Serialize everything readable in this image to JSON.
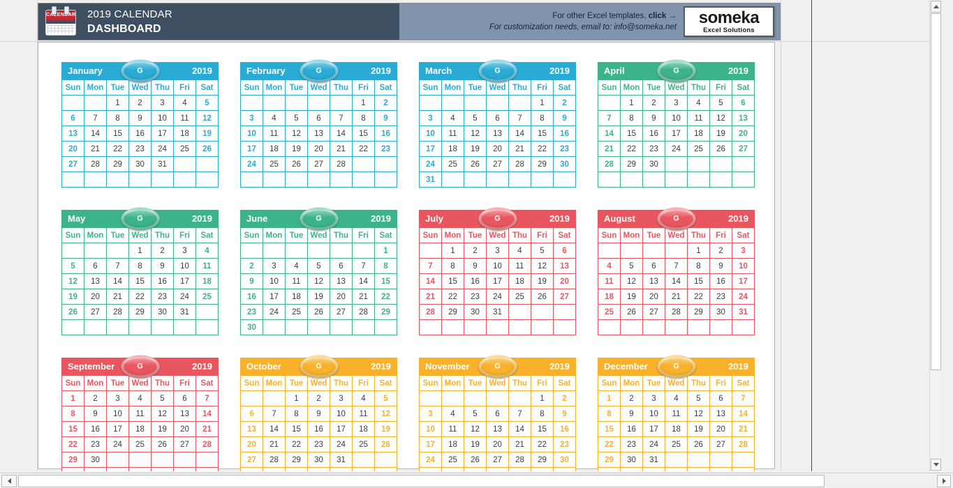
{
  "header": {
    "title_small": "2019 CALENDAR",
    "title_large": "DASHBOARD",
    "icon_label": "CALENDAR",
    "promo_line1_plain": "For other Excel templates, ",
    "promo_line1_bold": "click →",
    "promo_line2": "For customization needs, email to: info@someka.net",
    "logo_name": "someka",
    "logo_tagline": "Excel Solutions"
  },
  "badge_label": "G",
  "year": "2019",
  "weekdays": [
    "Sun",
    "Mon",
    "Tue",
    "Wed",
    "Thu",
    "Fri",
    "Sat"
  ],
  "colors": {
    "blue": "#29ABD4",
    "green": "#3DB38B",
    "red": "#E8575F",
    "orange": "#F7B12B",
    "banner_dark": "#3F4F62",
    "banner_light": "#8094AD",
    "weekday_text": "#3B3B3B"
  },
  "months": [
    {
      "name": "January",
      "color": "blue",
      "weeks": [
        [
          "",
          "",
          "1",
          "2",
          "3",
          "4",
          "5"
        ],
        [
          "6",
          "7",
          "8",
          "9",
          "10",
          "11",
          "12"
        ],
        [
          "13",
          "14",
          "15",
          "16",
          "17",
          "18",
          "19"
        ],
        [
          "20",
          "21",
          "22",
          "23",
          "24",
          "25",
          "26"
        ],
        [
          "27",
          "28",
          "29",
          "30",
          "31",
          "",
          ""
        ],
        [
          "",
          "",
          "",
          "",
          "",
          "",
          ""
        ]
      ]
    },
    {
      "name": "February",
      "color": "blue",
      "weeks": [
        [
          "",
          "",
          "",
          "",
          "",
          "1",
          "2"
        ],
        [
          "3",
          "4",
          "5",
          "6",
          "7",
          "8",
          "9"
        ],
        [
          "10",
          "11",
          "12",
          "13",
          "14",
          "15",
          "16"
        ],
        [
          "17",
          "18",
          "19",
          "20",
          "21",
          "22",
          "23"
        ],
        [
          "24",
          "25",
          "26",
          "27",
          "28",
          "",
          ""
        ],
        [
          "",
          "",
          "",
          "",
          "",
          "",
          ""
        ]
      ]
    },
    {
      "name": "March",
      "color": "blue",
      "weeks": [
        [
          "",
          "",
          "",
          "",
          "",
          "1",
          "2"
        ],
        [
          "3",
          "4",
          "5",
          "6",
          "7",
          "8",
          "9"
        ],
        [
          "10",
          "11",
          "12",
          "13",
          "14",
          "15",
          "16"
        ],
        [
          "17",
          "18",
          "19",
          "20",
          "21",
          "22",
          "23"
        ],
        [
          "24",
          "25",
          "26",
          "27",
          "28",
          "29",
          "30"
        ],
        [
          "31",
          "",
          "",
          "",
          "",
          "",
          ""
        ]
      ]
    },
    {
      "name": "April",
      "color": "green",
      "weeks": [
        [
          "",
          "1",
          "2",
          "3",
          "4",
          "5",
          "6"
        ],
        [
          "7",
          "8",
          "9",
          "10",
          "11",
          "12",
          "13"
        ],
        [
          "14",
          "15",
          "16",
          "17",
          "18",
          "19",
          "20"
        ],
        [
          "21",
          "22",
          "23",
          "24",
          "25",
          "26",
          "27"
        ],
        [
          "28",
          "29",
          "30",
          "",
          "",
          "",
          ""
        ],
        [
          "",
          "",
          "",
          "",
          "",
          "",
          ""
        ]
      ]
    },
    {
      "name": "May",
      "color": "green",
      "weeks": [
        [
          "",
          "",
          "",
          "1",
          "2",
          "3",
          "4"
        ],
        [
          "5",
          "6",
          "7",
          "8",
          "9",
          "10",
          "11"
        ],
        [
          "12",
          "13",
          "14",
          "15",
          "16",
          "17",
          "18"
        ],
        [
          "19",
          "20",
          "21",
          "22",
          "23",
          "24",
          "25"
        ],
        [
          "26",
          "27",
          "28",
          "29",
          "30",
          "31",
          ""
        ],
        [
          "",
          "",
          "",
          "",
          "",
          "",
          ""
        ]
      ]
    },
    {
      "name": "June",
      "color": "green",
      "weeks": [
        [
          "",
          "",
          "",
          "",
          "",
          "",
          "1"
        ],
        [
          "2",
          "3",
          "4",
          "5",
          "6",
          "7",
          "8"
        ],
        [
          "9",
          "10",
          "11",
          "12",
          "13",
          "14",
          "15"
        ],
        [
          "16",
          "17",
          "18",
          "19",
          "20",
          "21",
          "22"
        ],
        [
          "23",
          "24",
          "25",
          "26",
          "27",
          "28",
          "29"
        ],
        [
          "30",
          "",
          "",
          "",
          "",
          "",
          ""
        ]
      ]
    },
    {
      "name": "July",
      "color": "red",
      "weeks": [
        [
          "",
          "1",
          "2",
          "3",
          "4",
          "5",
          "6"
        ],
        [
          "7",
          "8",
          "9",
          "10",
          "11",
          "12",
          "13"
        ],
        [
          "14",
          "15",
          "16",
          "17",
          "18",
          "19",
          "20"
        ],
        [
          "21",
          "22",
          "23",
          "24",
          "25",
          "26",
          "27"
        ],
        [
          "28",
          "29",
          "30",
          "31",
          "",
          "",
          ""
        ],
        [
          "",
          "",
          "",
          "",
          "",
          "",
          ""
        ]
      ]
    },
    {
      "name": "August",
      "color": "red",
      "weeks": [
        [
          "",
          "",
          "",
          "",
          "1",
          "2",
          "3"
        ],
        [
          "4",
          "5",
          "6",
          "7",
          "8",
          "9",
          "10"
        ],
        [
          "11",
          "12",
          "13",
          "14",
          "15",
          "16",
          "17"
        ],
        [
          "18",
          "19",
          "20",
          "21",
          "22",
          "23",
          "24"
        ],
        [
          "25",
          "26",
          "27",
          "28",
          "29",
          "30",
          "31"
        ],
        [
          "",
          "",
          "",
          "",
          "",
          "",
          ""
        ]
      ]
    },
    {
      "name": "September",
      "color": "red",
      "weeks": [
        [
          "1",
          "2",
          "3",
          "4",
          "5",
          "6",
          "7"
        ],
        [
          "8",
          "9",
          "10",
          "11",
          "12",
          "13",
          "14"
        ],
        [
          "15",
          "16",
          "17",
          "18",
          "19",
          "20",
          "21"
        ],
        [
          "22",
          "23",
          "24",
          "25",
          "26",
          "27",
          "28"
        ],
        [
          "29",
          "30",
          "",
          "",
          "",
          "",
          ""
        ],
        [
          "",
          "",
          "",
          "",
          "",
          "",
          ""
        ]
      ]
    },
    {
      "name": "October",
      "color": "orange",
      "weeks": [
        [
          "",
          "",
          "1",
          "2",
          "3",
          "4",
          "5"
        ],
        [
          "6",
          "7",
          "8",
          "9",
          "10",
          "11",
          "12"
        ],
        [
          "13",
          "14",
          "15",
          "16",
          "17",
          "18",
          "19"
        ],
        [
          "20",
          "21",
          "22",
          "23",
          "24",
          "25",
          "26"
        ],
        [
          "27",
          "28",
          "29",
          "30",
          "31",
          "",
          ""
        ],
        [
          "",
          "",
          "",
          "",
          "",
          "",
          ""
        ]
      ]
    },
    {
      "name": "November",
      "color": "orange",
      "weeks": [
        [
          "",
          "",
          "",
          "",
          "",
          "1",
          "2"
        ],
        [
          "3",
          "4",
          "5",
          "6",
          "7",
          "8",
          "9"
        ],
        [
          "10",
          "11",
          "12",
          "13",
          "14",
          "15",
          "16"
        ],
        [
          "17",
          "18",
          "19",
          "20",
          "21",
          "22",
          "23"
        ],
        [
          "24",
          "25",
          "26",
          "27",
          "28",
          "29",
          "30"
        ],
        [
          "",
          "",
          "",
          "",
          "",
          "",
          ""
        ]
      ]
    },
    {
      "name": "December",
      "color": "orange",
      "weeks": [
        [
          "1",
          "2",
          "3",
          "4",
          "5",
          "6",
          "7"
        ],
        [
          "8",
          "9",
          "10",
          "11",
          "12",
          "13",
          "14"
        ],
        [
          "15",
          "16",
          "17",
          "18",
          "19",
          "20",
          "21"
        ],
        [
          "22",
          "23",
          "24",
          "25",
          "26",
          "27",
          "28"
        ],
        [
          "29",
          "30",
          "31",
          "",
          "",
          "",
          ""
        ],
        [
          "",
          "",
          "",
          "",
          "",
          "",
          ""
        ]
      ]
    }
  ]
}
